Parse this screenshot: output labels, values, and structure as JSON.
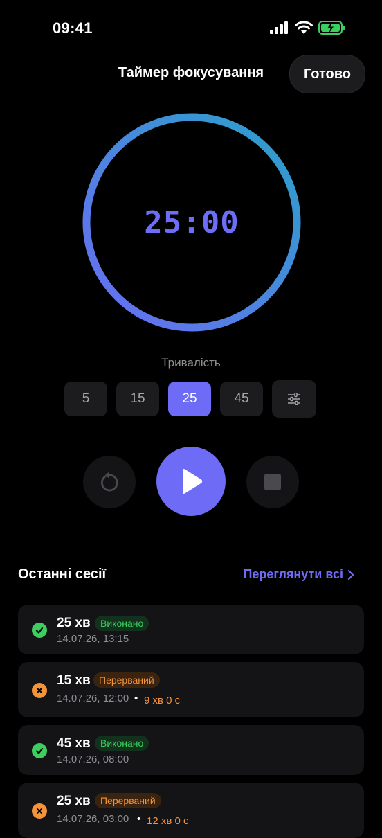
{
  "status_bar": {
    "time": "09:41",
    "icons": [
      "signal-icon",
      "wifi-icon",
      "battery-charging-icon"
    ]
  },
  "header": {
    "title": "Таймер фокусування",
    "done_label": "Готово"
  },
  "timer": {
    "display": "25:00",
    "progress": 1.0,
    "ring_colors": [
      "#2aa1c9",
      "#6a6cf4"
    ]
  },
  "duration": {
    "label": "Тривалість",
    "options": [
      "5",
      "15",
      "25",
      "45"
    ],
    "selected": "25",
    "settings_icon": "sliders-icon"
  },
  "controls": {
    "reset_icon": "reset-icon",
    "play_icon": "play-icon",
    "stop_icon": "stop-icon"
  },
  "recent": {
    "title": "Останні сесії",
    "view_all": "Переглянути всі",
    "sessions": [
      {
        "duration": "25 хв",
        "status": "Виконано",
        "date": "14.07.26, 13:15",
        "elapsed": ""
      },
      {
        "duration": "15 хв",
        "status": "Перерваний",
        "date": "14.07.26, 12:00",
        "elapsed": "9 хв 0 с"
      },
      {
        "duration": "45 хв",
        "status": "Виконано",
        "date": "14.07.26, 08:00",
        "elapsed": ""
      },
      {
        "duration": "25 хв",
        "status": "Перерваний",
        "date": "14.07.26, 03:00",
        "elapsed": "12 хв 0 с"
      }
    ]
  },
  "colors": {
    "accent": "#6e6cf6",
    "success": "#3ccf5f",
    "warning": "#f5933a",
    "background": "#000000"
  }
}
